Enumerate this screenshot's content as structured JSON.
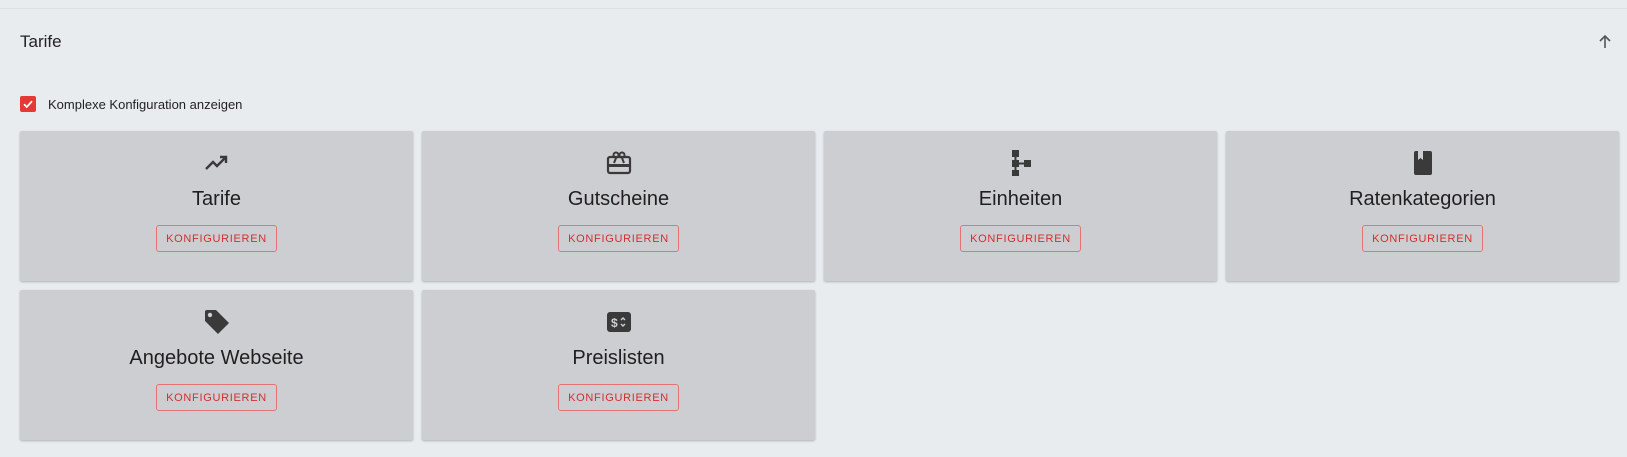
{
  "section": {
    "title": "Tarife"
  },
  "options": {
    "complex_config_label": "Komplexe Konfiguration anzeigen",
    "complex_config_checked": true
  },
  "colors": {
    "accent": "#e53935",
    "card_background": "#cdced2",
    "page_background": "#e8ecef",
    "icon": "#3a3a3a"
  },
  "cards": [
    {
      "title": "Tarife",
      "icon": "trending-up-icon",
      "button_label": "KONFIGURIEREN"
    },
    {
      "title": "Gutscheine",
      "icon": "gift-card-icon",
      "button_label": "KONFIGURIEREN"
    },
    {
      "title": "Einheiten",
      "icon": "hierarchy-icon",
      "button_label": "KONFIGURIEREN"
    },
    {
      "title": "Ratenkategorien",
      "icon": "book-icon",
      "button_label": "KONFIGURIEREN"
    },
    {
      "title": "Angebote Webseite",
      "icon": "tag-icon",
      "button_label": "KONFIGURIEREN"
    },
    {
      "title": "Preislisten",
      "icon": "price-list-icon",
      "button_label": "KONFIGURIEREN"
    }
  ]
}
